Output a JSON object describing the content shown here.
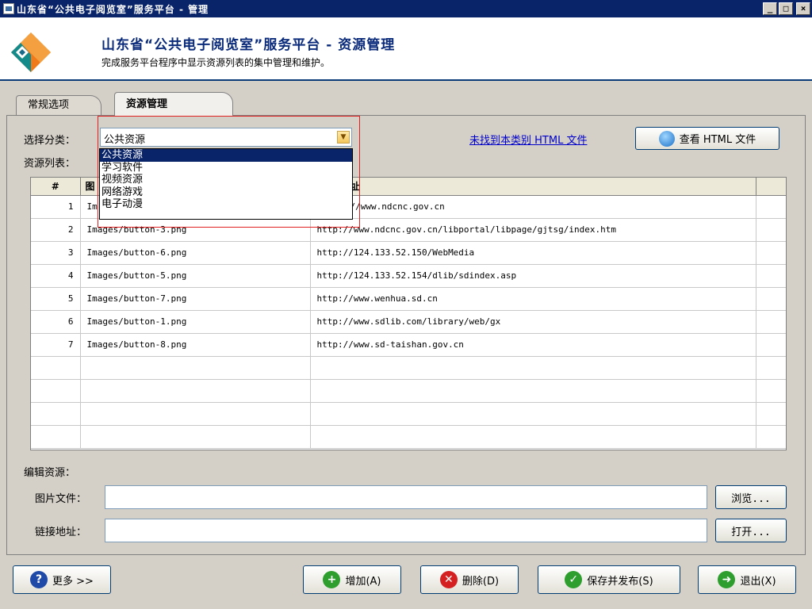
{
  "window": {
    "title": "山东省“公共电子阅览室”服务平台 - 管理"
  },
  "header": {
    "title": "山东省“公共电子阅览室”服务平台 - 资源管理",
    "subtitle": "完成服务平台程序中显示资源列表的集中管理和维护。"
  },
  "tabs": [
    {
      "label": "常规选项"
    },
    {
      "label": "资源管理"
    }
  ],
  "category": {
    "label": "选择分类：",
    "value": "公共资源",
    "options": [
      "公共资源",
      "学习软件",
      "视频资源",
      "网络游戏",
      "电子动漫"
    ],
    "selected_index": 0
  },
  "resource_list_label": "资源列表：",
  "html_link": "未找到本类别 HTML 文件",
  "view_html_button": "查看 HTML 文件",
  "table": {
    "columns": [
      "#",
      "图",
      "址"
    ],
    "rows": [
      {
        "n": "1",
        "image": "Im",
        "url": "//www.ndcnc.gov.cn"
      },
      {
        "n": "2",
        "image": "Images/button-3.png",
        "url": "http://www.ndcnc.gov.cn/libportal/libpage/gjtsg/index.htm"
      },
      {
        "n": "3",
        "image": "Images/button-6.png",
        "url": "http://124.133.52.150/WebMedia"
      },
      {
        "n": "4",
        "image": "Images/button-5.png",
        "url": "http://124.133.52.154/dlib/sdindex.asp"
      },
      {
        "n": "5",
        "image": "Images/button-7.png",
        "url": "http://www.wenhua.sd.cn"
      },
      {
        "n": "6",
        "image": "Images/button-1.png",
        "url": "http://www.sdlib.com/library/web/gx"
      },
      {
        "n": "7",
        "image": "Images/button-8.png",
        "url": "http://www.sd-taishan.gov.cn"
      }
    ]
  },
  "edit": {
    "section_label": "编辑资源：",
    "image_label": "图片文件：",
    "image_value": "",
    "link_label": "链接地址：",
    "link_value": "",
    "browse_button": "浏览...",
    "open_button": "打开..."
  },
  "footer": {
    "more": "更多 >>",
    "add": "增加(A)",
    "delete": "删除(D)",
    "save": "保存并发布(S)",
    "exit": "退出(X)"
  }
}
